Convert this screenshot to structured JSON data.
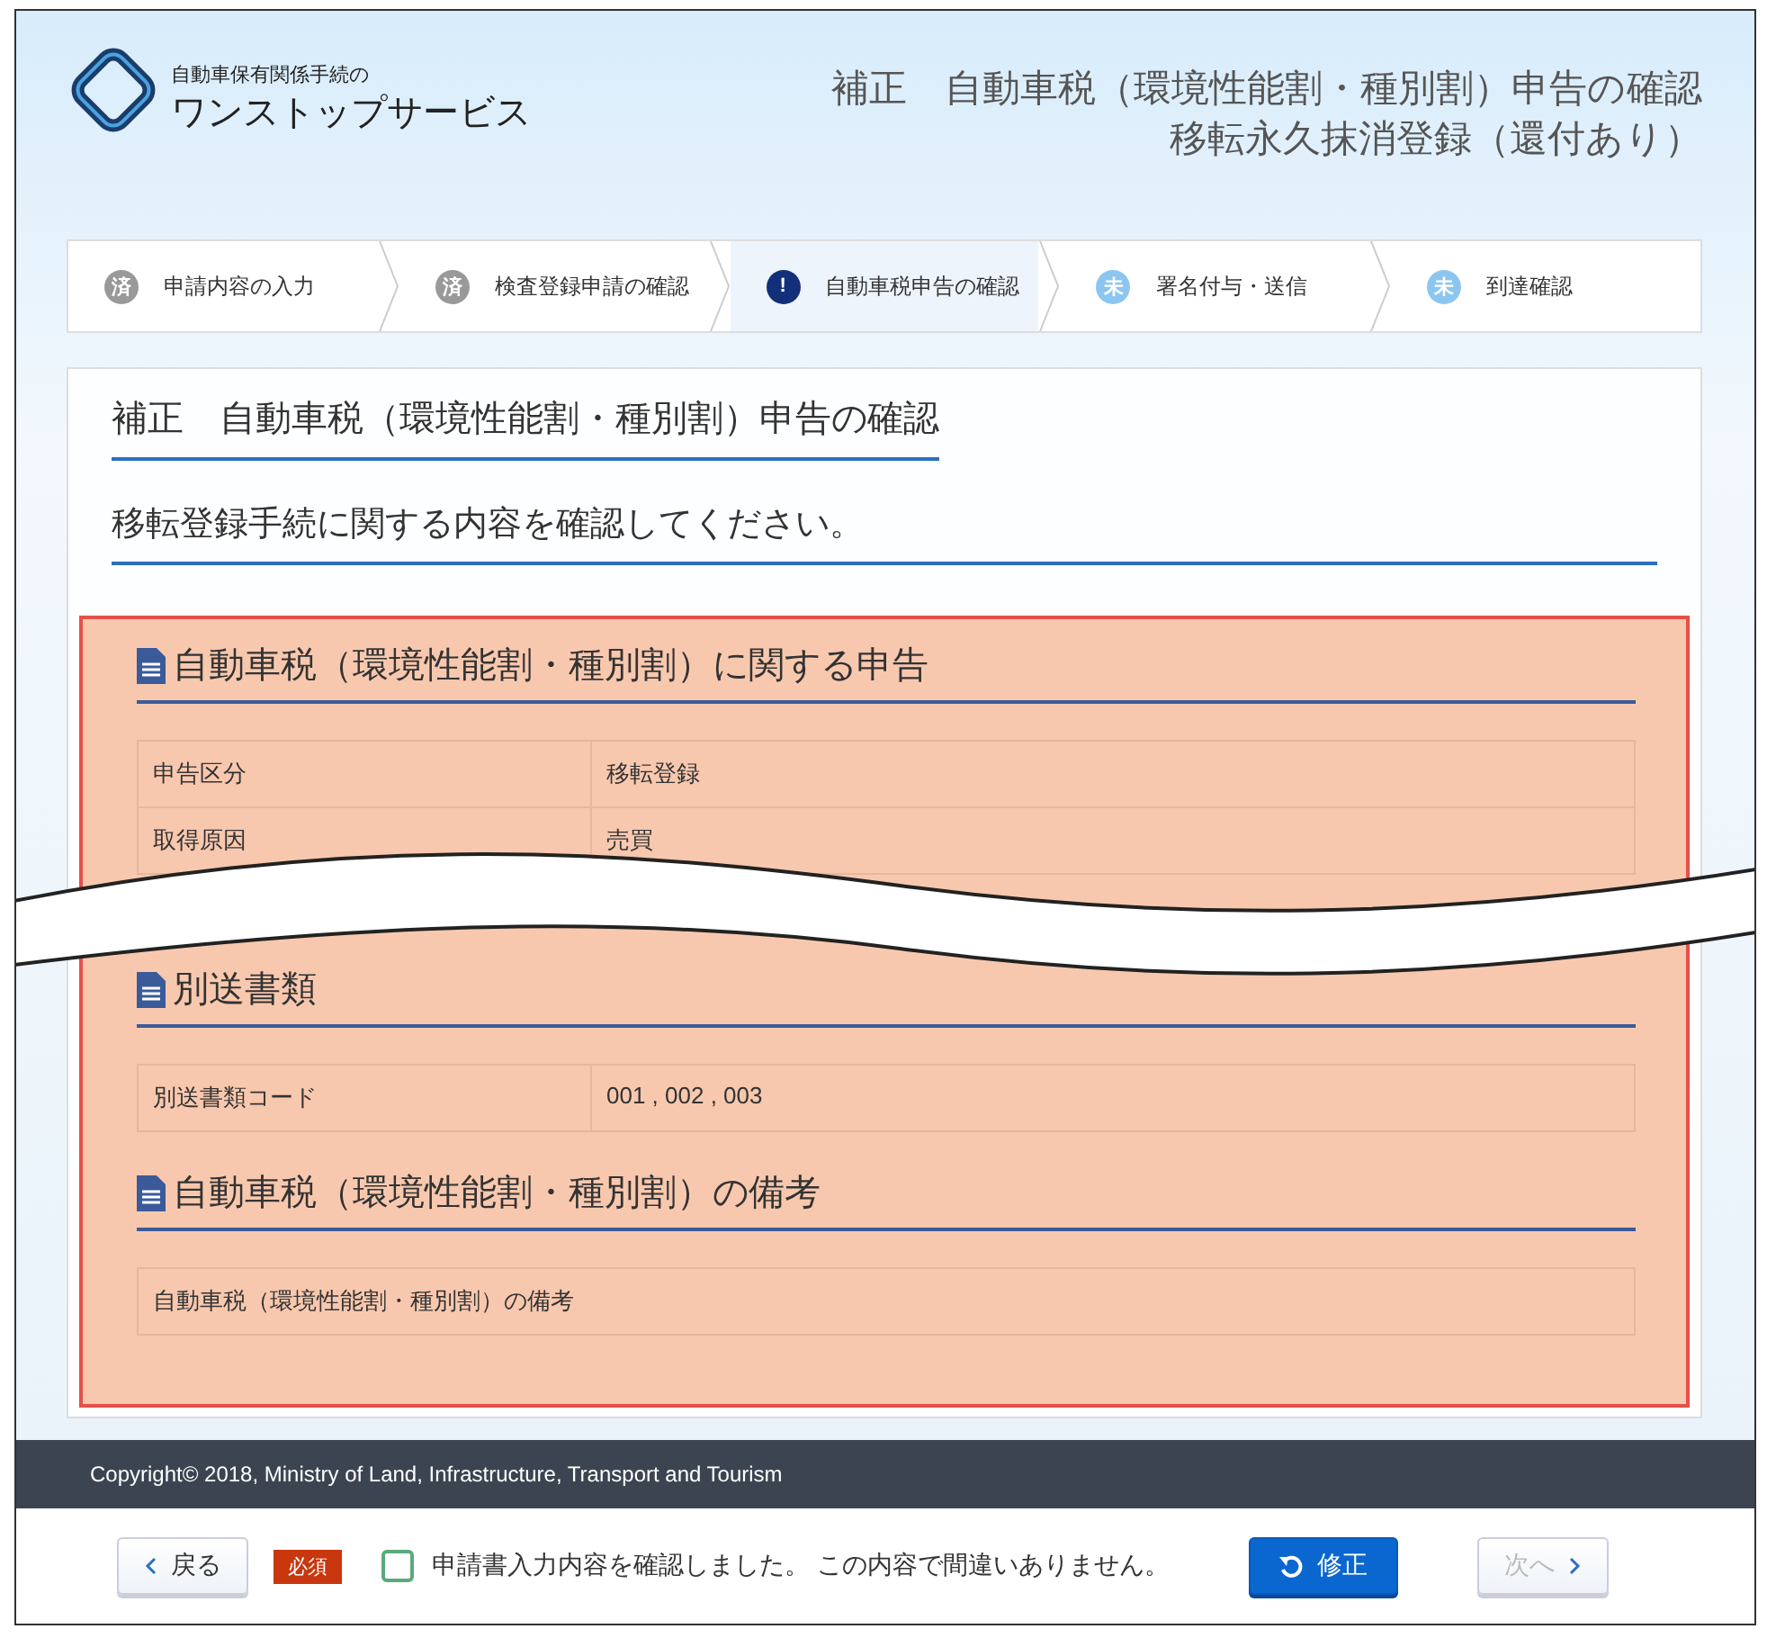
{
  "header": {
    "logo_subtitle": "自動車保有関係手続の",
    "logo_title": "ワンストップサービス",
    "title_lines": [
      "補正　自動車税（環境性能割・種別割）申告の確認",
      "移転永久抹消登録（還付あり）"
    ]
  },
  "steps": [
    {
      "badge": "済",
      "label": "申請内容の入力",
      "kind": "done",
      "selected": false
    },
    {
      "badge": "済",
      "label": "検査登録申請の確認",
      "kind": "done",
      "selected": false
    },
    {
      "badge": "!",
      "label": "自動車税申告の確認",
      "kind": "current",
      "selected": true
    },
    {
      "badge": "未",
      "label": "署名付与・送信",
      "kind": "todo",
      "selected": false
    },
    {
      "badge": "未",
      "label": "到達確認",
      "kind": "todo",
      "selected": false
    }
  ],
  "card": {
    "title": "補正　自動車税（環境性能割・種別割）申告の確認",
    "subtitle": "移転登録手続に関する内容を確認してください。",
    "sections": [
      {
        "heading": "自動車税（環境性能割・種別割）に関する申告",
        "rows": [
          {
            "label": "申告区分",
            "value": "移転登録"
          },
          {
            "label": "取得原因",
            "value": "売買"
          }
        ]
      },
      {
        "heading": "別送書類",
        "rows": [
          {
            "label": "別送書類コード",
            "value": "001 , 002 , 003"
          }
        ]
      },
      {
        "heading": "自動車税（環境性能割・種別割）の備考",
        "rows": [
          {
            "label": "自動車税（環境性能割・種別割）の備考"
          }
        ]
      }
    ]
  },
  "footer": {
    "copyright": "Copyright© 2018, Ministry of Land, Infrastructure, Transport and Tourism"
  },
  "actions": {
    "back_label": "戻る",
    "required_badge": "必須",
    "confirm": {
      "label": "申請書入力内容を確認しました。 この内容で間違いありません。",
      "checked": false
    },
    "edit_label": "修正",
    "next": {
      "label": "次へ",
      "disabled": true
    }
  }
}
